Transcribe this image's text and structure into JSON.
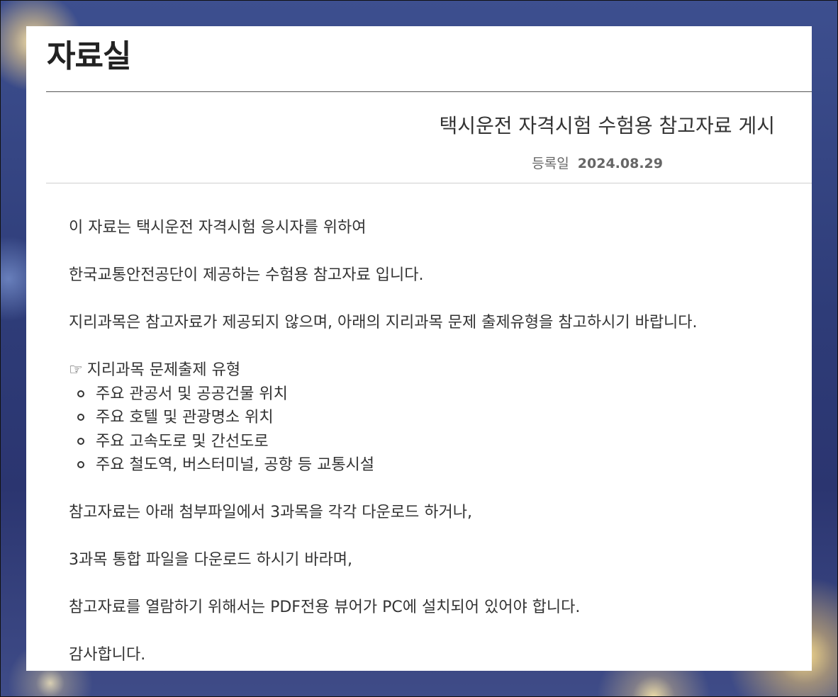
{
  "page": {
    "title": "자료실"
  },
  "post": {
    "title": "택시운전 자격시험 수험용 참고자료 게시",
    "date_label": "등록일",
    "date_value": "2024.08.29"
  },
  "body": {
    "p1": "이 자료는 택시운전 자격시험 응시자를 위하여",
    "p2": "한국교통안전공단이 제공하는 수험용 참고자료 입니다.",
    "p3": "지리과목은 참고자료가 제공되지 않으며, 아래의 지리과목 문제 출제유형을 참고하시기 바랍니다.",
    "list_heading_icon": "☞",
    "list_heading": "지리과목 문제출제 유형",
    "list": [
      "주요 관공서 및 공공건물 위치",
      "주요 호텔 및 관광명소 위치",
      "주요 고속도로 및 간선도로",
      "주요 철도역, 버스터미널, 공항 등 교통시설"
    ],
    "p4": "참고자료는 아래 첨부파일에서 3과목을 각각 다운로드 하거나,",
    "p5": "3과목 통합 파일을 다운로드 하시기 바라며,",
    "p6": "참고자료를 열람하기 위해서는 PDF전용 뷰어가 PC에 설치되어 있어야 합니다.",
    "p7": "감사합니다."
  }
}
